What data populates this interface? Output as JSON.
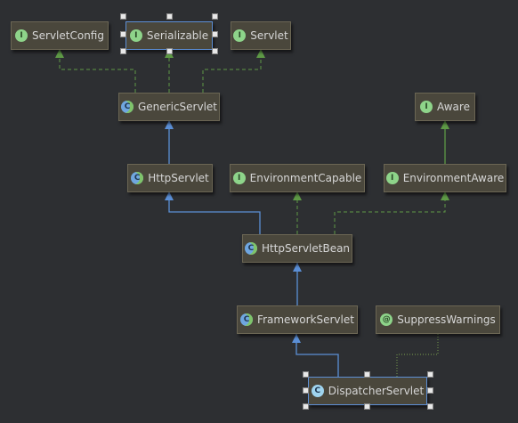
{
  "nodes": {
    "servlet_config": {
      "label": "ServletConfig",
      "kind": "interface",
      "badge": "I"
    },
    "serializable": {
      "label": "Serializable",
      "kind": "interface",
      "badge": "I"
    },
    "servlet": {
      "label": "Servlet",
      "kind": "interface",
      "badge": "I"
    },
    "generic_servlet": {
      "label": "GenericServlet",
      "kind": "abstract-class",
      "badge": "C"
    },
    "aware": {
      "label": "Aware",
      "kind": "interface",
      "badge": "I"
    },
    "http_servlet": {
      "label": "HttpServlet",
      "kind": "abstract-class",
      "badge": "C"
    },
    "environment_capable": {
      "label": "EnvironmentCapable",
      "kind": "interface",
      "badge": "I"
    },
    "environment_aware": {
      "label": "EnvironmentAware",
      "kind": "interface",
      "badge": "I"
    },
    "http_servlet_bean": {
      "label": "HttpServletBean",
      "kind": "abstract-class",
      "badge": "C"
    },
    "framework_servlet": {
      "label": "FrameworkServlet",
      "kind": "abstract-class",
      "badge": "C"
    },
    "suppress_warnings": {
      "label": "SuppressWarnings",
      "kind": "annotation",
      "badge": "@"
    },
    "dispatcher_servlet": {
      "label": "DispatcherServlet",
      "kind": "class",
      "badge": "C"
    }
  },
  "colors": {
    "extends_edge": "#5b8fd6",
    "implements_edge": "#5e9a46",
    "annotation_edge": "#6b8a4a",
    "node_fill": "#4a473c",
    "selection": "#5d8fd6"
  }
}
